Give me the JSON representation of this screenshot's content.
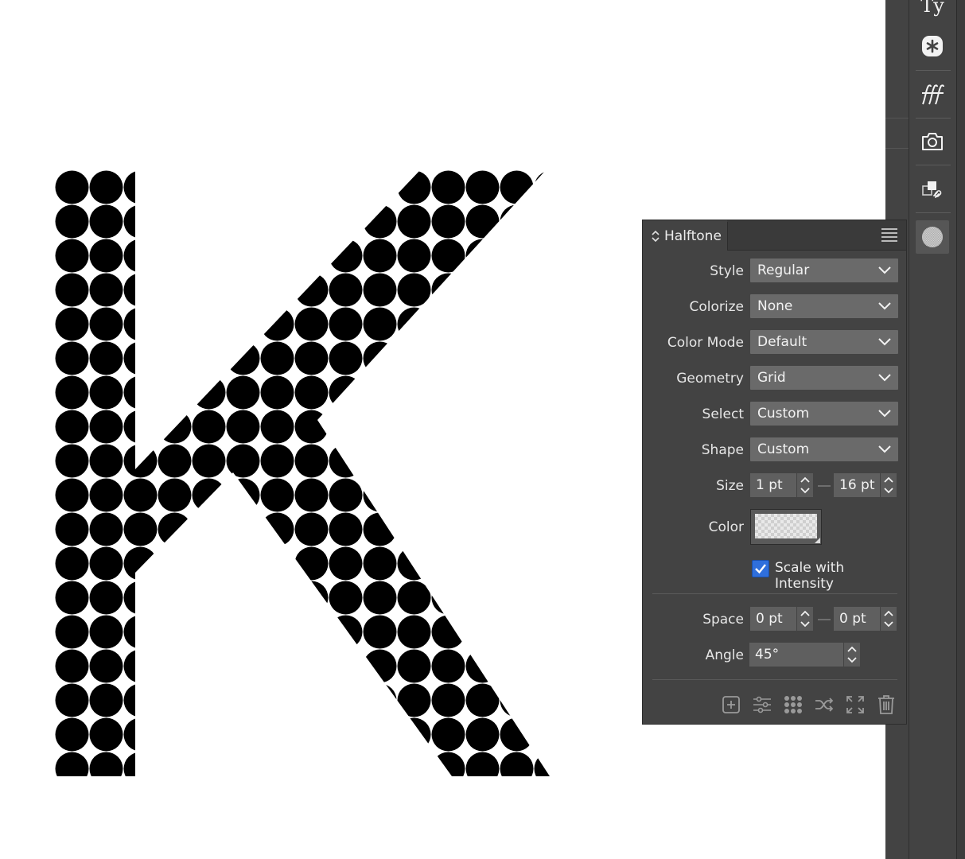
{
  "canvas": {
    "letter": "K",
    "fill_pattern": "halftone-dots",
    "colors": {
      "background": "#ffffff",
      "dots": "#000000"
    }
  },
  "toolbar": {
    "items": [
      {
        "name": "text-styles",
        "label": "Ty"
      },
      {
        "name": "glyphs-icon",
        "icon": "asterisk-badge-icon"
      },
      {
        "name": "font-manager",
        "icon": "fff-icon"
      },
      {
        "name": "snapshots",
        "icon": "camera-icon"
      },
      {
        "name": "links",
        "icon": "linked-layers-icon"
      },
      {
        "name": "halftone",
        "icon": "halftone-icon",
        "active": true
      }
    ]
  },
  "panel": {
    "title": "Halftone",
    "fields": {
      "style": {
        "label": "Style",
        "value": "Regular"
      },
      "colorize": {
        "label": "Colorize",
        "value": "None"
      },
      "color_mode": {
        "label": "Color Mode",
        "value": "Default"
      },
      "geometry": {
        "label": "Geometry",
        "value": "Grid"
      },
      "select": {
        "label": "Select",
        "value": "Custom"
      },
      "shape": {
        "label": "Shape",
        "value": "Custom"
      },
      "size": {
        "label": "Size",
        "min": "1 pt",
        "max": "16 pt"
      },
      "color": {
        "label": "Color",
        "value": "transparent"
      },
      "scale_with_intensity": {
        "label": "Scale with Intensity",
        "checked": true
      },
      "space": {
        "label": "Space",
        "min": "0 pt",
        "max": "0 pt"
      },
      "angle": {
        "label": "Angle",
        "value": "45°"
      }
    },
    "footer_icons": [
      "add-icon",
      "adjust-sliders-icon",
      "dot-grid-icon",
      "shuffle-icon",
      "expand-icon",
      "trash-icon"
    ],
    "accent_color": "#2f6fdc"
  }
}
